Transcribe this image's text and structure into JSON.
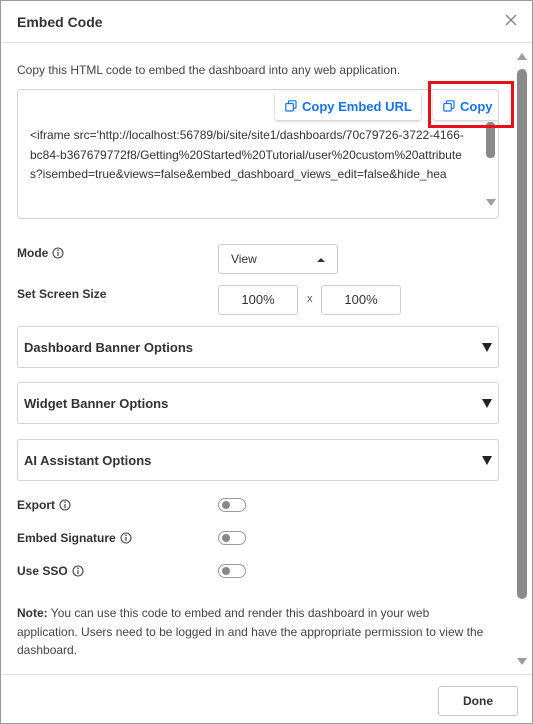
{
  "dialog": {
    "title": "Embed Code",
    "close_icon": "close-icon"
  },
  "instructions": "Copy this HTML code to embed the dashboard into any web application.",
  "code": {
    "text": "<iframe src='http://localhost:56789/bi/site/site1/dashboards/70c79726-3722-4166-bc84-b367679772f8/Getting%20Started%20Tutorial/user%20custom%20attributes?isembed=true&views=false&embed_dashboard_views_edit=false&hide_hea",
    "copy_embed_url_label": "Copy Embed URL",
    "copy_label": "Copy",
    "copy_icon": "copy-icon"
  },
  "mode": {
    "label": "Mode",
    "value": "View"
  },
  "screen_size": {
    "label": "Set Screen Size",
    "width": "100%",
    "separator": "x",
    "height": "100%"
  },
  "accordions": [
    {
      "label": "Dashboard Banner Options"
    },
    {
      "label": "Widget Banner Options"
    },
    {
      "label": "AI Assistant Options"
    }
  ],
  "toggles": {
    "export": {
      "label": "Export",
      "on": false
    },
    "embed_signature": {
      "label": "Embed Signature",
      "on": false
    },
    "use_sso": {
      "label": "Use SSO",
      "on": false
    }
  },
  "note": {
    "prefix": "Note:",
    "text": " You can use this code to embed and render this dashboard in your web application. Users need to be logged in and have the appropriate permission to view the dashboard."
  },
  "footer": {
    "done_label": "Done"
  },
  "colors": {
    "accent": "#1a73e8",
    "highlight": "#e8111b"
  }
}
